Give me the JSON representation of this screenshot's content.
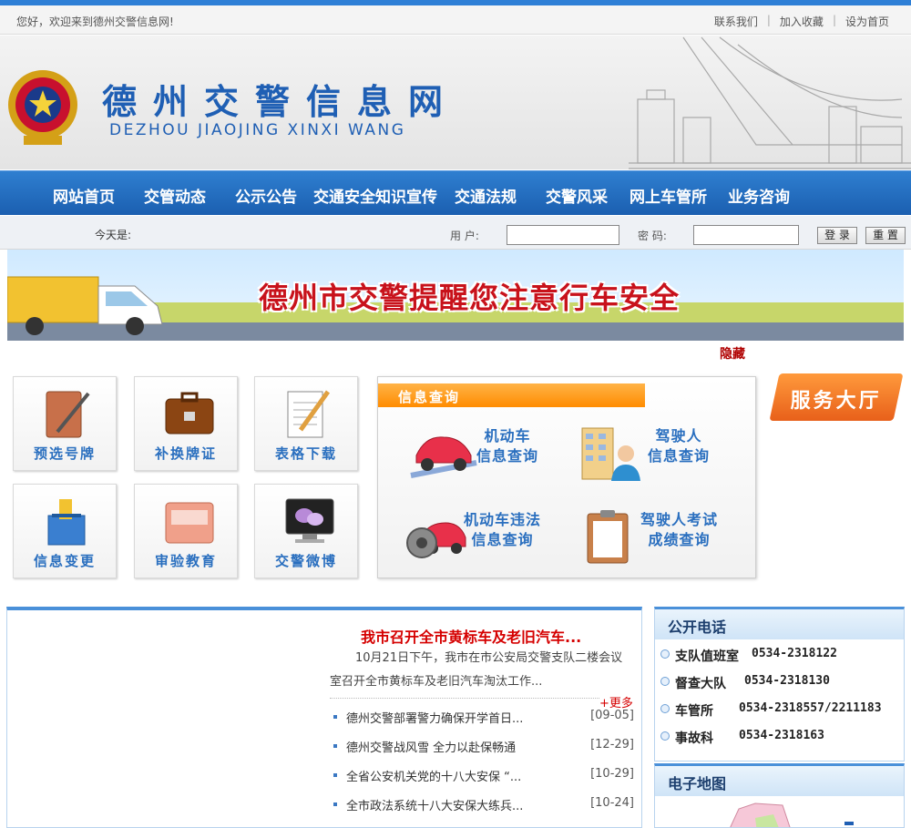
{
  "topbar": {
    "greeting": "您好，欢迎来到德州交警信息网!",
    "links": [
      "联系我们",
      "加入收藏",
      "设为首页"
    ]
  },
  "header": {
    "title_cn": "德州交警信息网",
    "title_en": "DEZHOU JIAOJING XINXI WANG"
  },
  "nav": [
    "网站首页",
    "交管动态",
    "公示公告",
    "交通安全知识宣传",
    "交通法规",
    "交警风采",
    "网上车管所",
    "业务咨询"
  ],
  "login": {
    "today_label": "今天是:",
    "user_label": "用 户:",
    "pass_label": "密 码:",
    "login_button": "登 录",
    "reset_button": "重 置"
  },
  "banner": {
    "text": "德州市交警提醒您注意行车安全",
    "hide_link": "隐藏"
  },
  "tiles": [
    {
      "label": "预选号牌",
      "icon": "notebook-pen-icon"
    },
    {
      "label": "补换牌证",
      "icon": "briefcase-icon"
    },
    {
      "label": "表格下载",
      "icon": "notepad-pencil-icon"
    },
    {
      "label": "信息变更",
      "icon": "ballot-box-icon"
    },
    {
      "label": "审验教育",
      "icon": "folder-icon"
    },
    {
      "label": "交警微博",
      "icon": "monitor-chat-icon"
    }
  ],
  "info_query": {
    "title": "信息查询",
    "items": [
      {
        "line1": "机动车",
        "line2": "信息查询",
        "icon": "car-icon"
      },
      {
        "line1": "驾驶人",
        "line2": "信息查询",
        "icon": "driver-icon"
      },
      {
        "line1": "机动车违法",
        "line2": "信息查询",
        "icon": "car-lock-icon"
      },
      {
        "line1": "驾驶人考试",
        "line2": "成绩查询",
        "icon": "clipboard-icon"
      }
    ]
  },
  "service_hall": "服务大厅",
  "news": {
    "headline": "我市召开全市黄标车及老旧汽车...",
    "summary": "10月21日下午，我市在市公安局交警支队二楼会议室召开全市黄标车及老旧汽车淘汰工作...",
    "more": "+更多",
    "items": [
      {
        "title": "德州交警部署警力确保开学首日...",
        "date": "[09-05]"
      },
      {
        "title": "德州交警战风雪 全力以赴保畅通",
        "date": "[12-29]"
      },
      {
        "title": "全省公安机关党的十八大安保 “...",
        "date": "[10-29]"
      },
      {
        "title": "全市政法系统十八大安保大练兵...",
        "date": "[10-24]"
      }
    ]
  },
  "phones": {
    "title": "公开电话",
    "items": [
      {
        "name": "支队值班室",
        "number": "0534-2318122"
      },
      {
        "name": "督查大队",
        "number": "0534-2318130"
      },
      {
        "name": "车管所",
        "number": "0534-2318557/2211183"
      },
      {
        "name": "事故科",
        "number": "0534-2318163"
      }
    ]
  },
  "map": {
    "title": "电子地图"
  },
  "colors": {
    "primary": "#1f5fb4",
    "nav": "#2f7fd0",
    "accent": "#ff8c00",
    "red": "#d50000"
  }
}
